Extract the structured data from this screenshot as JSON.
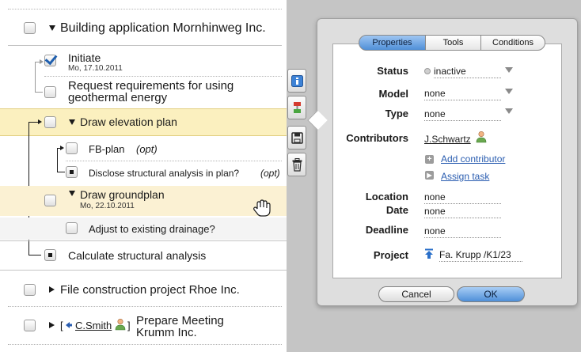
{
  "tasks": {
    "building_application": "Building application Mornhinweg Inc.",
    "initiate": "Initiate",
    "initiate_date": "Mo, 17.10.2011",
    "request_line1": "Request requirements for using",
    "request_line2": "geothermal energy",
    "draw_elevation": "Draw elevation plan",
    "fb_plan": "FB-plan",
    "opt_label": "(opt)",
    "disclose": "Disclose structural analysis in plan?",
    "disclose_opt": "(opt)",
    "draw_groundplan": "Draw groundplan",
    "groundplan_date": "Mo, 22.10.2011",
    "adjust": "Adjust to existing drainage?",
    "calculate": "Calculate structural analysis",
    "file_construction": "File construction project Rhoe Inc.",
    "prepare_prefix": "[",
    "prepare_user": "C.Smith",
    "prepare_suffix": "]",
    "prepare_line1": "Prepare Meeting",
    "prepare_line2": "Krumm Inc."
  },
  "toolbar": {
    "info_icon": "info-icon",
    "flag_icon": "flag-icon",
    "save_icon": "save-icon",
    "trash_icon": "trash-icon"
  },
  "dialog": {
    "tabs": [
      "Properties",
      "Tools",
      "Conditions"
    ],
    "active_tab": "Properties",
    "fields": {
      "status_label": "Status",
      "status_value": "inactive",
      "model_label": "Model",
      "model_value": "none",
      "type_label": "Type",
      "type_value": "none",
      "contributors_label": "Contributors",
      "contributor": "J.Schwartz",
      "add_contributor": "Add contributor",
      "assign_task": "Assign task",
      "location_label": "Location",
      "location_value": "none",
      "date_label": "Date",
      "date_value": "none",
      "deadline_label": "Deadline",
      "deadline_value": "none",
      "project_label": "Project",
      "project_value": "Fa. Krupp /K1/23"
    },
    "cancel_label": "Cancel",
    "ok_label": "OK"
  },
  "colors": {
    "accent_blue": "#4f8fd8",
    "highlight_yellow": "#fbf0bf",
    "panel_grey": "#c5c5c5"
  }
}
